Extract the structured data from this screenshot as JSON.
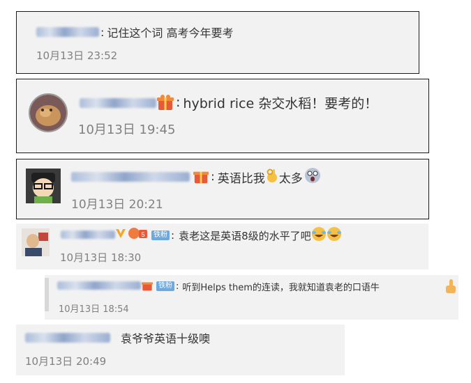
{
  "comments": [
    {
      "colon": ":",
      "text": "记住这个词 高考今年要考",
      "time": "10月13日 23:52"
    },
    {
      "colon": ":",
      "text": "hybrid rice 杂交水稻！要考的！",
      "time": "10月13日 19:45"
    },
    {
      "colon": ":",
      "text_a": "英语比我",
      "text_b": "太多",
      "time": "10月13日 20:21"
    },
    {
      "badge": "铁粉",
      "colon": ":",
      "text": "袁老这是英语8级的水平了吧",
      "time": "10月13日 18:30"
    },
    {
      "badge": "铁粉",
      "colon": ":",
      "text": "听到Helps them的连读，我就知道袁老的口语牛",
      "time": "10月13日 18:54"
    },
    {
      "text": "袁爷爷英语十级噢",
      "time": "10月13日 20:49"
    }
  ],
  "icons": {
    "vip": "vip-badge-icon",
    "ok_hand": "ok-hand-emoji-icon",
    "shocked": "shocked-emoji-icon",
    "laugh_cry": "laugh-cry-emoji-icon",
    "thumbs_up": "thumbs-up-icon",
    "verified": "verified-v-icon",
    "gift": "gift-icon"
  },
  "colors": {
    "card_bg": "#f2f2f2",
    "frame": "#1a1a1a",
    "time": "#808080",
    "badge": "#6fa8dc"
  }
}
